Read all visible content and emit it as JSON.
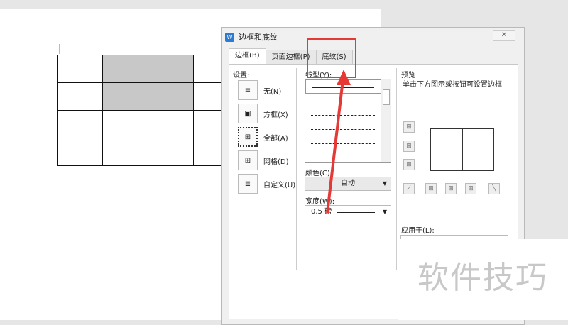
{
  "dialog": {
    "title": "边框和底纹",
    "close": "✕",
    "tabs": [
      {
        "label": "边框(B)"
      },
      {
        "label": "页面边框(P)"
      },
      {
        "label": "底纹(S)"
      }
    ],
    "settings_label": "设置:",
    "settings": [
      {
        "label": "无(N)"
      },
      {
        "label": "方框(X)"
      },
      {
        "label": "全部(A)"
      },
      {
        "label": "网格(D)"
      },
      {
        "label": "自定义(U)"
      }
    ],
    "style_label": "线型(Y):",
    "color_label": "颜色(C):",
    "color_value": "自动",
    "width_label": "宽度(W):",
    "width_value": "0.5 磅",
    "preview_label": "预览",
    "preview_hint": "单击下方图示或按钮可设置边框",
    "apply_label": "应用于(L):"
  },
  "watermark": "软件技巧",
  "colors": {
    "highlight": "#e53935",
    "cell_shade": "#c8c8c8"
  }
}
